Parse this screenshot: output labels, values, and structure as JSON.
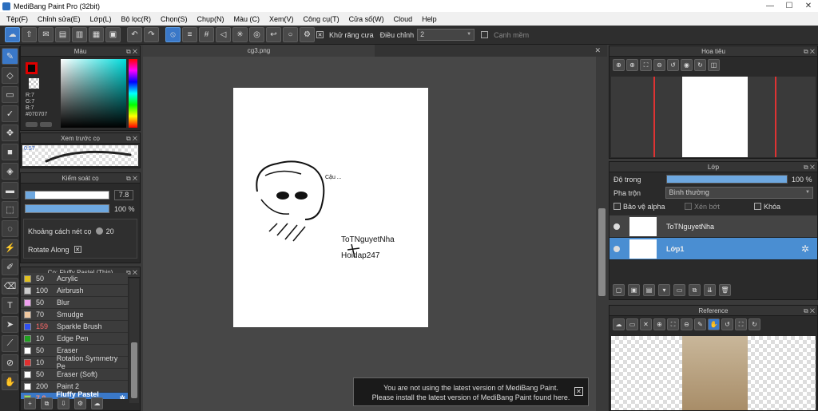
{
  "window": {
    "title": "MediBang Paint Pro (32bit)",
    "minimize": "—",
    "maximize": "☐",
    "close": "✕"
  },
  "menu": [
    "Tệp(F)",
    "Chỉnh sửa(E)",
    "Lớp(L)",
    "Bộ lọc(R)",
    "Chọn(S)",
    "Chụp(N)",
    "Màu (C)",
    "Xem(V)",
    "Công cụ(T)",
    "Cửa số(W)",
    "Cloud",
    "Help"
  ],
  "toolbar": {
    "antialias_label": "Khử răng cưa",
    "correction_label": "Điều chỉnh",
    "correction_value": "2",
    "smooth_label": "Cạnh mềm",
    "accent": "#3a78c8"
  },
  "color_panel": {
    "title": "Màu",
    "r": "R:7",
    "g": "G:7",
    "b": "B:7",
    "hex": "#070707"
  },
  "brush_preview": {
    "title": "Xem trước cọ",
    "size": "0.57"
  },
  "brush_control": {
    "title": "Kiểm soát cọ",
    "size_value": "7.8",
    "opacity_value": "100 %",
    "size_fraction": 0.12,
    "opacity_fraction": 1.0,
    "spacing_label": "Khoảng cách nét cọ",
    "spacing_value": "20",
    "rotate_label": "Rotate Along"
  },
  "brush_list": {
    "title": "Cọ: Fluffy Pastel (Thin)",
    "items": [
      {
        "size": "50",
        "name": "Acrylic",
        "color": "#e0c020"
      },
      {
        "size": "100",
        "name": "Airbrush",
        "color": "#cccccc"
      },
      {
        "size": "50",
        "name": "Blur",
        "color": "#f0a0f0"
      },
      {
        "size": "70",
        "name": "Smudge",
        "color": "#f0c8a0"
      },
      {
        "size": "159",
        "name": "Sparkle Brush",
        "color": "#3050f0",
        "size_color": "#ff6a6a"
      },
      {
        "size": "10",
        "name": "Edge Pen",
        "color": "#20a020"
      },
      {
        "size": "50",
        "name": "Eraser",
        "color": "#ffffff"
      },
      {
        "size": "10",
        "name": "Rotation Symmetry Pe",
        "color": "#e03030"
      },
      {
        "size": "50",
        "name": "Eraser (Soft)",
        "color": "#ffffff"
      },
      {
        "size": "200",
        "name": "Paint 2",
        "color": "#ffffff"
      },
      {
        "size": "7.8",
        "name": "Fluffy Pastel (Thin)",
        "color": "#90e060",
        "size_color": "#ff8a6a"
      }
    ]
  },
  "canvas": {
    "tab": "cg3.png",
    "text_note": "Cậu ...",
    "text_name": "ToTNguyetNha",
    "text_site": "Hoidap247"
  },
  "navigator": {
    "title": "Hoa tiêu"
  },
  "layer_panel": {
    "title": "Lớp",
    "opacity_label": "Độ trong",
    "opacity_value": "100 %",
    "opacity_fraction": 1.0,
    "blend_label": "Pha trộn",
    "blend_value": "Bình thường",
    "protect_alpha": "Bảo vệ alpha",
    "clip": "Xén bớt",
    "lock": "Khóa",
    "layers": [
      {
        "name": "ToTNguyetNha"
      },
      {
        "name": "Lớp1"
      }
    ]
  },
  "reference": {
    "title": "Reference"
  },
  "notice": {
    "line1": "You are not using the latest version of MediBang Paint.",
    "line2": "Please install the latest version of MediBang Paint found here."
  }
}
